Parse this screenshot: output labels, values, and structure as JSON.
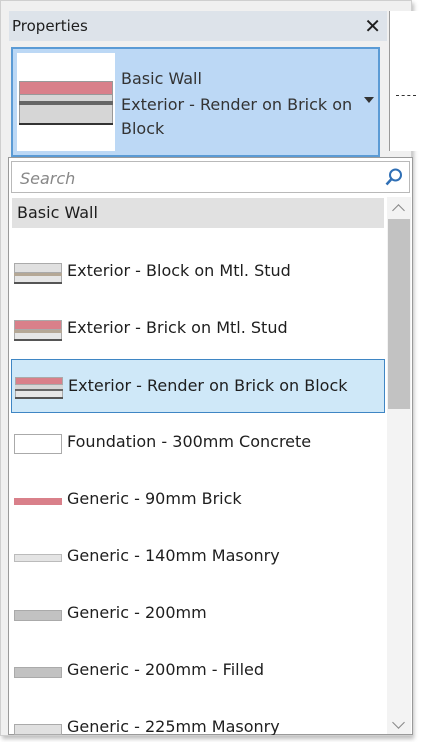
{
  "palette": {
    "accent": "#5b9bd5",
    "selected_bg": "#cfe8f8",
    "brick": "#d9808a",
    "masonry": "#dcdcdc",
    "dark_line": "#8a8a8a"
  },
  "properties": {
    "title": "Properties",
    "close_icon": "close-icon",
    "type_selector": {
      "family": "Basic Wall",
      "type_name": "Exterior - Render on Brick on Block",
      "arrow_icon": "chevron-down-icon"
    }
  },
  "dropdown": {
    "search": {
      "placeholder": "Search",
      "value": "",
      "icon": "search-icon"
    },
    "group_header": "Basic Wall",
    "items": [
      {
        "label": "Exterior - Block on Mtl. Stud",
        "selected": false
      },
      {
        "label": "Exterior - Brick on Mtl. Stud",
        "selected": false
      },
      {
        "label": "Exterior - Render on Brick on Block",
        "selected": true
      },
      {
        "label": "Foundation - 300mm Concrete",
        "selected": false
      },
      {
        "label": "Generic - 90mm Brick",
        "selected": false
      },
      {
        "label": "Generic - 140mm Masonry",
        "selected": false
      },
      {
        "label": "Generic - 200mm",
        "selected": false
      },
      {
        "label": "Generic - 200mm - Filled",
        "selected": false
      },
      {
        "label": "Generic - 225mm Masonry",
        "selected": false
      }
    ]
  }
}
